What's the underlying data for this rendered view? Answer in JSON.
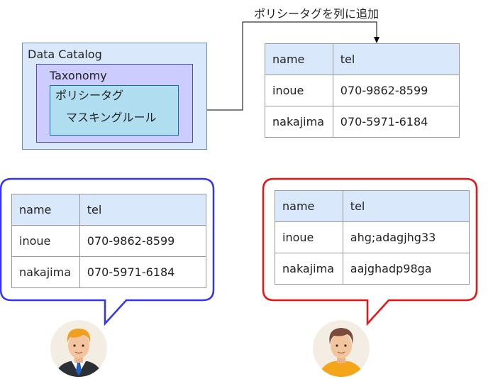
{
  "annotation": "ポリシータグを列に追加",
  "catalog": {
    "data_catalog_label": "Data Catalog",
    "taxonomy_label": "Taxonomy",
    "policy_tag_label": "ポリシータグ",
    "masking_rule_label": "マスキングルール"
  },
  "top_table": {
    "headers": [
      "name",
      "tel"
    ],
    "rows": [
      [
        "inoue",
        "070-9862-8599"
      ],
      [
        "nakajima",
        "070-5971-6184"
      ]
    ]
  },
  "left_bubble": {
    "border_color": "#3333ff",
    "headers": [
      "name",
      "tel"
    ],
    "rows": [
      [
        "inoue",
        "070-9862-8599"
      ],
      [
        "nakajima",
        "070-5971-6184"
      ]
    ]
  },
  "right_bubble": {
    "border_color": "#ee1111",
    "headers": [
      "name",
      "tel"
    ],
    "rows": [
      [
        "inoue",
        "ahg;adagjhg33"
      ],
      [
        "nakajima",
        "aajghadp98ga"
      ]
    ]
  },
  "users": [
    {
      "icon": "businessman-avatar-icon",
      "shirt_color": "#ffffff",
      "tie_color": "#1f5fbf",
      "hair_color": "#f0a020"
    },
    {
      "icon": "casual-user-avatar-icon",
      "shirt_color": "#f5a51a",
      "hair_color": "#7a4a3a"
    }
  ],
  "colors": {
    "catalog_fill": "#dae8fc",
    "taxonomy_fill": "#ccccff",
    "policy_fill": "#b1ddf0",
    "table_header_fill": "#dae8fc"
  }
}
